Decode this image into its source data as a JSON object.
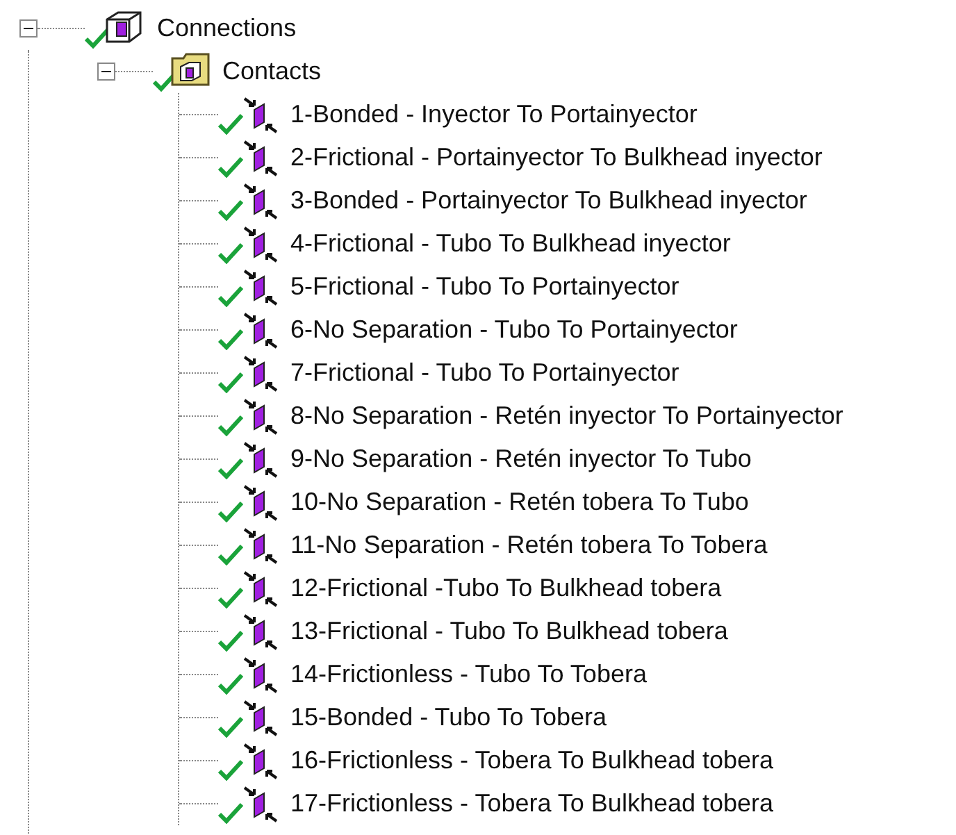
{
  "tree": {
    "label": "Connections",
    "expanded": true,
    "children": [
      {
        "label": "Contacts",
        "expanded": true,
        "children": [
          {
            "label": "1-Bonded - Inyector To Portainyector"
          },
          {
            "label": "2-Frictional - Portainyector To Bulkhead inyector"
          },
          {
            "label": "3-Bonded - Portainyector To Bulkhead inyector"
          },
          {
            "label": "4-Frictional - Tubo  To Bulkhead inyector"
          },
          {
            "label": "5-Frictional - Tubo To Portainyector"
          },
          {
            "label": "6-No Separation - Tubo To Portainyector"
          },
          {
            "label": "7-Frictional - Tubo To Portainyector"
          },
          {
            "label": "8-No Separation - Retén inyector To Portainyector"
          },
          {
            "label": "9-No Separation - Retén inyector To Tubo"
          },
          {
            "label": "10-No Separation - Retén tobera To Tubo"
          },
          {
            "label": "11-No Separation - Retén tobera To Tobera"
          },
          {
            "label": "12-Frictional -Tubo To Bulkhead tobera"
          },
          {
            "label": "13-Frictional - Tubo To Bulkhead tobera"
          },
          {
            "label": "14-Frictionless - Tubo To Tobera"
          },
          {
            "label": "15-Bonded - Tubo To Tobera"
          },
          {
            "label": "16-Frictionless - Tobera To Bulkhead tobera"
          },
          {
            "label": "17-Frictionless - Tobera To Bulkhead tobera"
          }
        ]
      }
    ]
  }
}
